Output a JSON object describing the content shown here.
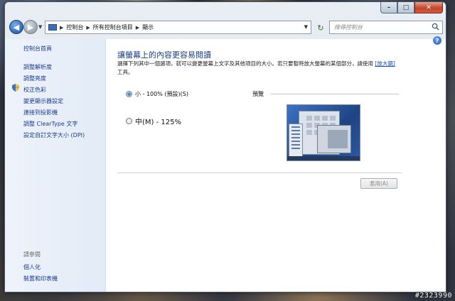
{
  "window": {
    "caption": {
      "minimize": "–",
      "maximize": "□",
      "close": "✕"
    }
  },
  "nav": {
    "breadcrumbs": [
      "控制台",
      "所有控制台項目",
      "顯示"
    ],
    "search_placeholder": "搜尋控制台"
  },
  "sidebar": {
    "home": "控制台首頁",
    "items": [
      "調整解析度",
      "調整亮度",
      "校正色彩",
      "變更顯示器設定",
      "連接到投影機",
      "調整 ClearType 文字",
      "設定自訂文字大小 (DPI)"
    ],
    "see_also_title": "請參閱",
    "see_also": [
      "個人化",
      "裝置和印表機"
    ]
  },
  "main": {
    "title": "讓螢幕上的內容更容易閱讀",
    "desc_before": "選擇下列其中一個選項，就可以變更螢幕上文字及其他項目的大小。若只要暫時放大螢幕的某個部分，請使用",
    "desc_link": "[放大鏡]",
    "desc_after": " 工具。",
    "options": [
      {
        "label": "小 - 100% (預設)(S)",
        "selected": true
      },
      {
        "label": "中(M) - 125%",
        "selected": false
      }
    ],
    "preview_label": "預覽",
    "apply_label": "套用(A)"
  },
  "watermark": "#2323990"
}
